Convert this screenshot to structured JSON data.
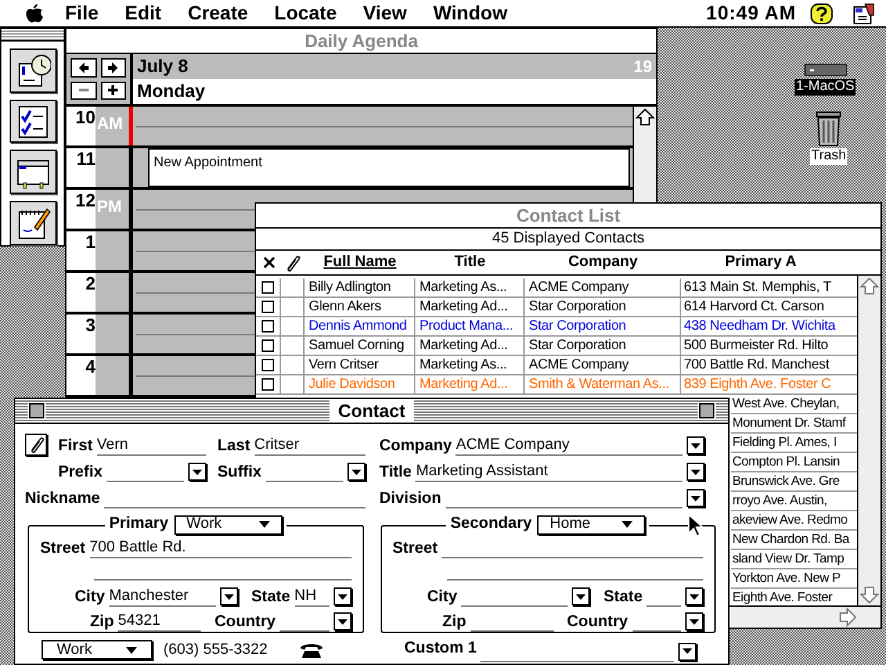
{
  "menu_bar": {
    "menus": [
      "File",
      "Edit",
      "Create",
      "Locate",
      "View",
      "Window"
    ],
    "clock": "10:49 AM"
  },
  "desktop_icons": [
    {
      "label": "1-MacOS",
      "kind": "disk",
      "selected": true
    },
    {
      "label": "Trash",
      "kind": "trash",
      "selected": false
    }
  ],
  "tool_palette": {
    "tools": [
      {
        "kind": "calendar"
      },
      {
        "kind": "checklist"
      },
      {
        "kind": "card"
      },
      {
        "kind": "notepad"
      }
    ]
  },
  "daily_agenda": {
    "title": "Daily Agenda",
    "date": "July 8",
    "weekday": "Monday",
    "week_number": "19",
    "hours": [
      {
        "hour": "10",
        "period": "AM",
        "current": true
      },
      {
        "hour": "11",
        "current": false,
        "appointment": "New Appointment"
      },
      {
        "hour": "12",
        "period": "PM",
        "current": false
      },
      {
        "hour": "1",
        "current": false
      },
      {
        "hour": "2",
        "current": false
      },
      {
        "hour": "3",
        "current": false
      },
      {
        "hour": "4",
        "current": false
      }
    ]
  },
  "contact_list": {
    "title": "Contact List",
    "count": "45 Displayed Contacts",
    "columns": [
      "Full Name",
      "Title",
      "Company",
      "Primary A"
    ],
    "rows": [
      {
        "name": "Billy Adlington",
        "title": "Marketing As...",
        "company": "ACME Company",
        "address": "613 Main St. Memphis, T",
        "color": "#000000",
        "checked": false
      },
      {
        "name": "Glenn Akers",
        "title": "Marketing Ad...",
        "company": "Star Corporation",
        "address": "614 Harvord Ct. Carson",
        "color": "#000000",
        "checked": false
      },
      {
        "name": "Dennis Ammond",
        "title": "Product Mana...",
        "company": "Star Corporation",
        "address": "438 Needham Dr. Wichita",
        "color": "#0000dd",
        "checked": false
      },
      {
        "name": "Samuel Corning",
        "title": "Marketing Ad...",
        "company": "Star Corporation",
        "address": "500 Burmeister Rd. Hilto",
        "color": "#000000",
        "checked": false
      },
      {
        "name": "Vern Critser",
        "title": "Marketing As...",
        "company": "ACME Company",
        "address": "700 Battle Rd. Manchest",
        "color": "#000000",
        "checked": false
      },
      {
        "name": "Julie Davidson",
        "title": "Marketing Ad...",
        "company": "Smith & Waterman As...",
        "address": "839 Eighth Ave. Foster C",
        "color": "#ff6600",
        "checked": false
      },
      {
        "address": "West Ave. Cheylan,",
        "color": "#000000"
      },
      {
        "address": "Monument Dr. Stamf",
        "color": "#000000"
      },
      {
        "address": "Fielding Pl. Ames, I",
        "color": "#000000"
      },
      {
        "address": "Compton Pl. Lansin",
        "color": "#000000"
      },
      {
        "address": "Brunswick Ave. Gre",
        "color": "#000000"
      },
      {
        "address": "rroyo Ave. Austin,",
        "color": "#000000"
      },
      {
        "address": "akeview Ave. Redmo",
        "color": "#000000"
      },
      {
        "address": "New Chardon Rd. Ba",
        "color": "#000000"
      },
      {
        "address": "sland View Dr. Tamp",
        "color": "#000000"
      },
      {
        "address": "Yorkton Ave. New P",
        "color": "#000000"
      },
      {
        "address": "Eighth Ave. Foster",
        "color": "#000000"
      }
    ]
  },
  "contact": {
    "title": "Contact",
    "header_rows": [
      [
        {
          "label": "First",
          "value": "Vern",
          "dropdown": false
        },
        {
          "label": "Last",
          "value": "Critser",
          "dropdown": false
        },
        {
          "label": "Company",
          "value": "ACME Company",
          "dropdown": true
        }
      ],
      [
        {
          "label": "Prefix",
          "dropdown": true
        },
        {
          "label": "Suffix",
          "dropdown": true
        },
        {
          "label": "Title",
          "value": "Marketing Assistant",
          "dropdown": true
        }
      ],
      [
        {
          "label": "Nickname",
          "dropdown": false
        },
        {
          "label": "Division",
          "dropdown": true
        }
      ]
    ],
    "addresses": [
      {
        "legend": "Primary",
        "type": "Work",
        "fields": [
          {
            "label": "Street",
            "value": "700 Battle Rd.",
            "dropdown": false
          },
          {
            "label": "City",
            "value": "Manchester",
            "dropdown": true
          },
          {
            "label": "State",
            "value": "NH",
            "dropdown": true
          },
          {
            "label": "Zip",
            "value": "54321",
            "dropdown": false
          },
          {
            "label": "Country",
            "dropdown": true
          }
        ]
      },
      {
        "legend": "Secondary",
        "type": "Home",
        "fields": [
          {
            "label": "Street",
            "dropdown": false
          },
          {
            "label": "City",
            "dropdown": true
          },
          {
            "label": "State",
            "dropdown": true
          },
          {
            "label": "Zip",
            "dropdown": false
          },
          {
            "label": "Country",
            "dropdown": true
          }
        ]
      }
    ],
    "phone": {
      "type": "Work",
      "number": "(603) 555-3322"
    },
    "custom_label": "Custom 1"
  }
}
